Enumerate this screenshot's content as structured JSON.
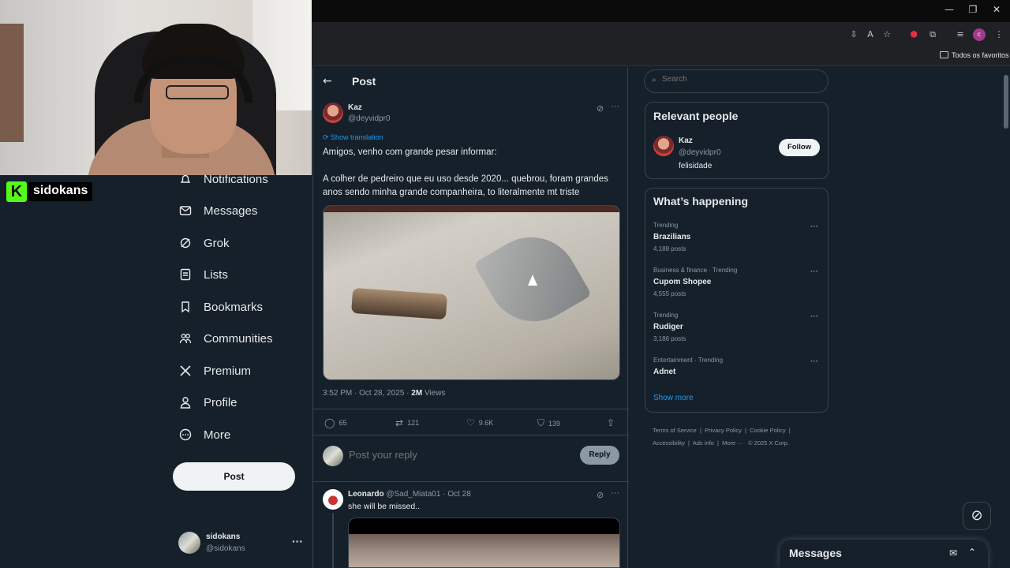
{
  "browser": {
    "bookmarks_label": "Todos os favoritos",
    "window_controls": [
      "—",
      "❐",
      "✕"
    ]
  },
  "stream": {
    "channel_name": "sidokans",
    "logo_letter": "K",
    "brand_color": "#53fc18"
  },
  "nav": {
    "items": [
      {
        "label": "Notifications",
        "icon": "bell-icon"
      },
      {
        "label": "Messages",
        "icon": "envelope-icon"
      },
      {
        "label": "Grok",
        "icon": "grok-icon"
      },
      {
        "label": "Lists",
        "icon": "list-icon"
      },
      {
        "label": "Bookmarks",
        "icon": "bookmark-icon"
      },
      {
        "label": "Communities",
        "icon": "people-icon"
      },
      {
        "label": "Premium",
        "icon": "x-logo-icon"
      },
      {
        "label": "Profile",
        "icon": "person-icon"
      },
      {
        "label": "More",
        "icon": "more-circle-icon"
      }
    ],
    "post_button": "Post",
    "account": {
      "name": "sidokans",
      "handle": "@sidokans"
    }
  },
  "post": {
    "header_title": "Post",
    "author_name": "Kaz",
    "author_handle": "@deyvidpr0",
    "show_translation": "Show translation",
    "text_line1": "Amigos, venho com grande pesar informar:",
    "text_line2": "A colher de pedreiro que eu uso desde 2020... quebrou, foram grandes anos sendo minha grande companheira, to literalmente mt triste",
    "timestamp": "3:52 PM · Oct 28, 2025 · ",
    "views_count": "2M",
    "views_label": " Views",
    "stats": {
      "replies": "65",
      "reposts": "121",
      "likes": "9.6K",
      "bookmarks": "139"
    },
    "reply_placeholder": "Post your reply",
    "reply_button": "Reply"
  },
  "reply_item": {
    "name": "Leonardo",
    "handle": "@Sad_Miata01",
    "date": "· Oct 28",
    "text": "she will be missed.."
  },
  "sidebar": {
    "search_placeholder": "Search",
    "relevant_title": "Relevant people",
    "relevant_person": {
      "name": "Kaz",
      "handle": "@deyvidpr0",
      "bio": "felisidade",
      "follow_label": "Follow"
    },
    "happening_title": "What’s happening",
    "trends": [
      {
        "context": "Trending",
        "title": "Brazilians",
        "count": "4,188 posts"
      },
      {
        "context": "Business & finance · Trending",
        "title": "Cupom Shopee",
        "count": "4,555 posts"
      },
      {
        "context": "Trending",
        "title": "Rudiger",
        "count": "3,186 posts"
      },
      {
        "context": "Entertainment · Trending",
        "title": "Adnet",
        "count": ""
      }
    ],
    "show_more": "Show more",
    "footer": [
      "Terms of Service",
      "Privacy Policy",
      "Cookie Policy",
      "Accessibility",
      "Ads info",
      "More ···",
      "© 2025 X Corp."
    ]
  },
  "messages_drawer": {
    "title": "Messages"
  },
  "colors": {
    "background": "#15202b",
    "border": "#38444d",
    "accent": "#1d9bf0",
    "muted": "#8b98a5"
  }
}
